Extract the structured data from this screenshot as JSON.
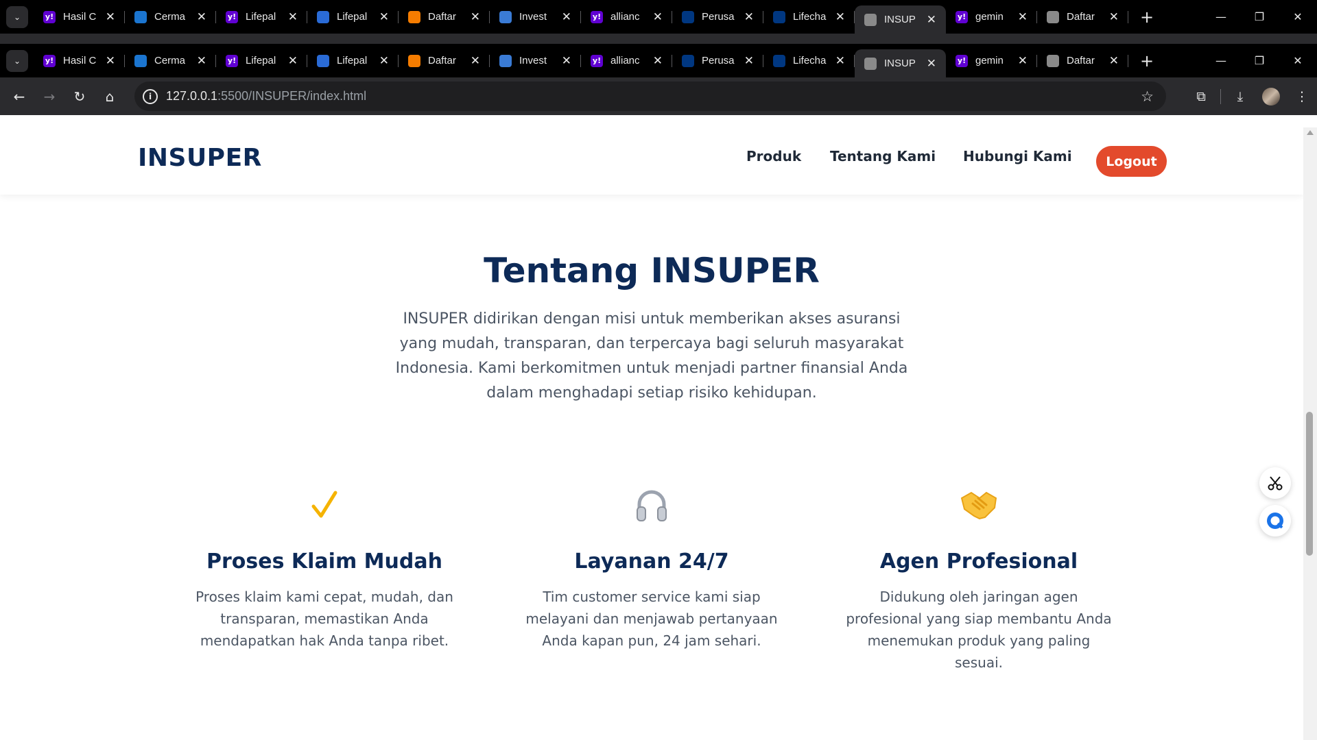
{
  "browser": {
    "tabs": [
      {
        "label": "Hasil C",
        "icon": "yahoo-icon",
        "color": "#6001d2"
      },
      {
        "label": "Cerma",
        "icon": "cermati-icon",
        "color": "#1b75d0"
      },
      {
        "label": "Lifepal",
        "icon": "yahoo-icon",
        "color": "#6001d2"
      },
      {
        "label": "Lifepal",
        "icon": "lifepal-icon",
        "color": "#2a6bd6"
      },
      {
        "label": "Daftar",
        "icon": "blogger-icon",
        "color": "#f57c00"
      },
      {
        "label": "Invest",
        "icon": "invest-icon",
        "color": "#3a7bd5"
      },
      {
        "label": "allianc",
        "icon": "yahoo-icon",
        "color": "#6001d2"
      },
      {
        "label": "Perusa",
        "icon": "allianz-icon",
        "color": "#003781"
      },
      {
        "label": "Lifecha",
        "icon": "allianz-icon",
        "color": "#003781"
      },
      {
        "label": "INSUP",
        "icon": "globe-icon",
        "color": "#8a8a8a",
        "active": true
      },
      {
        "label": "gemin",
        "icon": "yahoo-icon",
        "color": "#6001d2"
      },
      {
        "label": "Daftar",
        "icon": "globe-icon",
        "color": "#8a8a8a"
      }
    ],
    "url_host": "127.0.0.1",
    "url_path": ":5500/INSUPER/index.html"
  },
  "site": {
    "brand": "INSUPER",
    "nav": [
      "Produk",
      "Tentang Kami",
      "Hubungi Kami"
    ],
    "logout": "Logout"
  },
  "about": {
    "title": "Tentang INSUPER",
    "text": "INSUPER didirikan dengan misi untuk memberikan akses asuransi yang mudah, transparan, dan terpercaya bagi seluruh masyarakat Indonesia. Kami berkomitmen untuk menjadi partner finansial Anda dalam menghadapi setiap risiko kehidupan."
  },
  "features": [
    {
      "icon": "checkmark-icon",
      "title": "Proses Klaim Mudah",
      "text": "Proses klaim kami cepat, mudah, dan transparan, memastikan Anda mendapatkan hak Anda tanpa ribet."
    },
    {
      "icon": "headphones-icon",
      "title": "Layanan 24/7",
      "text": "Tim customer service kami siap melayani dan menjawab pertanyaan Anda kapan pun, 24 jam sehari."
    },
    {
      "icon": "handshake-icon",
      "title": "Agen Profesional",
      "text": "Didukung oleh jaringan agen profesional yang siap membantu Anda menemukan produk yang paling sesuai."
    }
  ],
  "colors": {
    "brand": "#0d2a57",
    "accent": "#e34a2c",
    "check": "#f5b301"
  }
}
